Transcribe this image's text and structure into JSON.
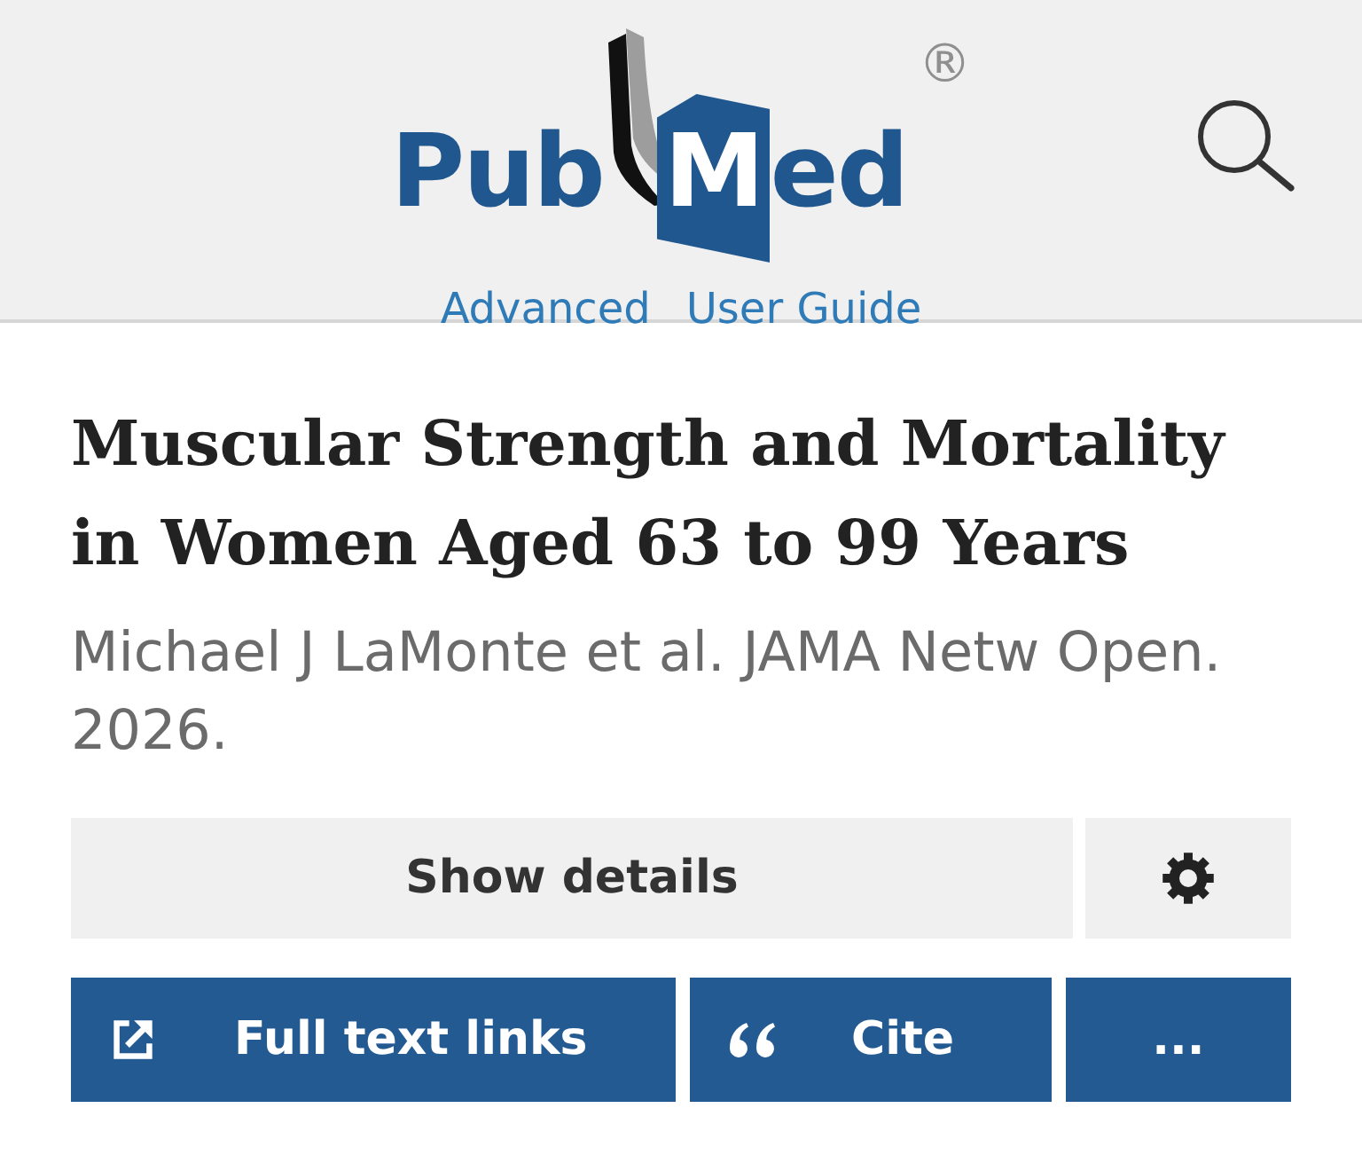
{
  "header": {
    "logo": {
      "text_before_book": "Pub",
      "letter_on_page": "M",
      "text_after_page": "ed",
      "registered_mark": "®"
    },
    "links": [
      "Advanced",
      "User Guide"
    ]
  },
  "article": {
    "title": "Muscular Strength and Mortality in Women Aged 63 to 99 Years",
    "citation": "Michael J LaMonte et al. JAMA Netw Open. 2026."
  },
  "action_rows": [
    [
      {
        "kind": "details",
        "label": "Show details"
      },
      {
        "kind": "settings"
      }
    ],
    [
      {
        "kind": "full_text",
        "label": "Full text links"
      },
      {
        "kind": "cite",
        "label": "Cite"
      },
      {
        "kind": "more",
        "label": "..."
      }
    ]
  ]
}
